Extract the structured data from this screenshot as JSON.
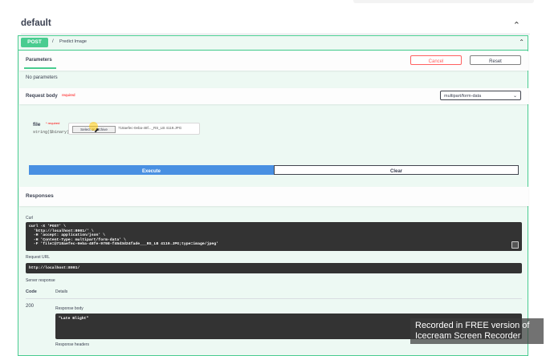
{
  "tag": {
    "title": "default"
  },
  "operation": {
    "method": "POST",
    "path": "/",
    "description": "Predict Image"
  },
  "parameters": {
    "tab_label": "Parameters",
    "cancel_label": "Cancel",
    "reset_label": "Reset",
    "no_params_text": "No parameters"
  },
  "request_body": {
    "title": "Request body",
    "required_label": "required",
    "content_type": "multipart/form-data",
    "file_field": {
      "name": "file",
      "required_marker": "* required",
      "type": "string($binary)",
      "button_label": "Select or Archive",
      "file_name": "718aefec-0eba-48f..._RS_LB 4119.JPG"
    }
  },
  "actions": {
    "execute_label": "Execute",
    "clear_label": "Clear"
  },
  "responses": {
    "title": "Responses",
    "curl_label": "Curl",
    "curl_lines": [
      "curl -X 'POST' \\",
      "  'http://localhost:8001/' \\",
      "  -H 'accept: application/json' \\",
      "  -H 'Content-Type: multipart/form-data' \\",
      "  -F 'file=@718aefec-0eba-48fe-9798-f45d3d24fade___RS_LB 4119.JPG;type=image/jpeg'"
    ],
    "request_url_label": "Request URL",
    "request_url": "http://localhost:8001/",
    "server_response_label": "Server response",
    "code_header": "Code",
    "details_header": "Details",
    "status_code": "200",
    "response_body_label": "Response body",
    "response_body": "\"Late Blight\"",
    "response_headers_label": "Response headers"
  },
  "watermark": {
    "line1": "Recorded in FREE version of",
    "line2": "Icecream Screen Recorder"
  }
}
